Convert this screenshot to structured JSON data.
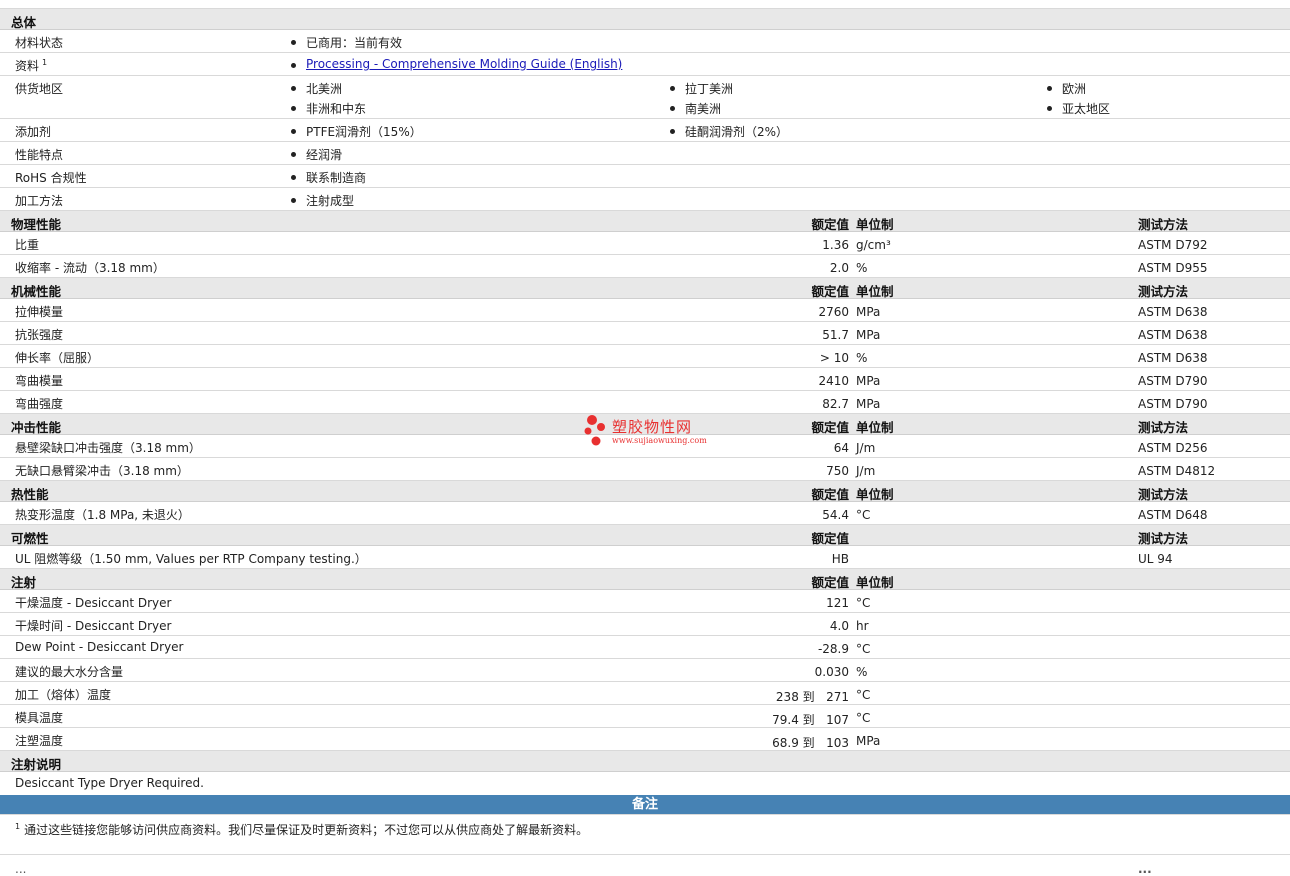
{
  "overview": {
    "title": "总体",
    "material_status": {
      "label": "材料状态",
      "value": "已商用：当前有效"
    },
    "resources": {
      "label": "资料",
      "sup": "1",
      "link": "Processing - Comprehensive Molding Guide (English)"
    },
    "supply": {
      "label": "供货地区",
      "regions": [
        "北美洲",
        "拉丁美洲",
        "欧洲",
        "非洲和中东",
        "南美洲",
        "亚太地区"
      ]
    },
    "additives": {
      "label": "添加剂",
      "items": [
        "PTFE润滑剂（15%）",
        "硅酮润滑剂（2%）"
      ]
    },
    "features": {
      "label": "性能特点",
      "value": "经润滑"
    },
    "rohs": {
      "label": "RoHS 合规性",
      "value": "联系制造商"
    },
    "processing": {
      "label": "加工方法",
      "value": "注射成型"
    }
  },
  "columns": {
    "nominal": "额定值",
    "unit": "单位制",
    "test": "测试方法"
  },
  "physical": {
    "title": "物理性能",
    "rows": [
      {
        "label": "比重",
        "value": "1.36",
        "unit": "g/cm³",
        "test": "ASTM D792"
      },
      {
        "label": "收缩率  - 流动（3.18 mm）",
        "value": "2.0",
        "unit": "%",
        "test": "ASTM D955"
      }
    ]
  },
  "mechanical": {
    "title": "机械性能",
    "rows": [
      {
        "label": "拉伸模量",
        "value": "2760",
        "unit": "MPa",
        "test": "ASTM D638"
      },
      {
        "label": "抗张强度",
        "value": "51.7",
        "unit": "MPa",
        "test": "ASTM D638"
      },
      {
        "label": "伸长率（屈服）",
        "value": "> 10",
        "unit": "%",
        "test": "ASTM D638"
      },
      {
        "label": "弯曲模量",
        "value": "2410",
        "unit": "MPa",
        "test": "ASTM D790"
      },
      {
        "label": "弯曲强度",
        "value": "82.7",
        "unit": "MPa",
        "test": "ASTM D790"
      }
    ]
  },
  "impact": {
    "title": "冲击性能",
    "rows": [
      {
        "label": "悬壁梁缺口冲击强度（3.18 mm）",
        "value": "64",
        "unit": "J/m",
        "test": "ASTM D256"
      },
      {
        "label": "无缺口悬臂梁冲击（3.18 mm）",
        "value": "750",
        "unit": "J/m",
        "test": "ASTM D4812"
      }
    ]
  },
  "thermal": {
    "title": "热性能",
    "rows": [
      {
        "label": "热变形温度（1.8 MPa, 未退火）",
        "value": "54.4",
        "unit": "°C",
        "test": "ASTM D648"
      }
    ]
  },
  "flammability": {
    "title": "可燃性",
    "rows": [
      {
        "label": "UL 阻燃等级（1.50 mm, Values per RTP Company testing.）",
        "value": "HB",
        "unit": "",
        "test": "UL 94"
      }
    ]
  },
  "injection": {
    "title": "注射",
    "rows": [
      {
        "label": "干燥温度  - Desiccant Dryer",
        "value": "121",
        "unit": "°C"
      },
      {
        "label": "干燥时间  - Desiccant Dryer",
        "value": "4.0",
        "unit": "hr"
      },
      {
        "label": "Dew Point - Desiccant Dryer",
        "value": "-28.9",
        "unit": "°C"
      },
      {
        "label": "建议的最大水分含量",
        "value": "0.030",
        "unit": "%"
      },
      {
        "label": "加工（熔体）温度",
        "value": "238 到   271",
        "unit": "°C"
      },
      {
        "label": "模具温度",
        "value": "79.4 到   107",
        "unit": "°C"
      },
      {
        "label": "注塑温度",
        "value": "68.9 到   103",
        "unit": "MPa"
      }
    ]
  },
  "injection_notes": {
    "title": "注射说明",
    "text": "Desiccant Type Dryer Required."
  },
  "remarks": {
    "title": "备注",
    "sup": "1",
    "footnote": "通过这些链接您能够访问供应商资料。我们尽量保证及时更新资料；不过您可以从供应商处了解最新资料。"
  },
  "watermark": {
    "name": "塑胶物性网",
    "url": "www.sujiaowuxing.com"
  },
  "cutoff": {
    "label": "...",
    "test": "..."
  }
}
